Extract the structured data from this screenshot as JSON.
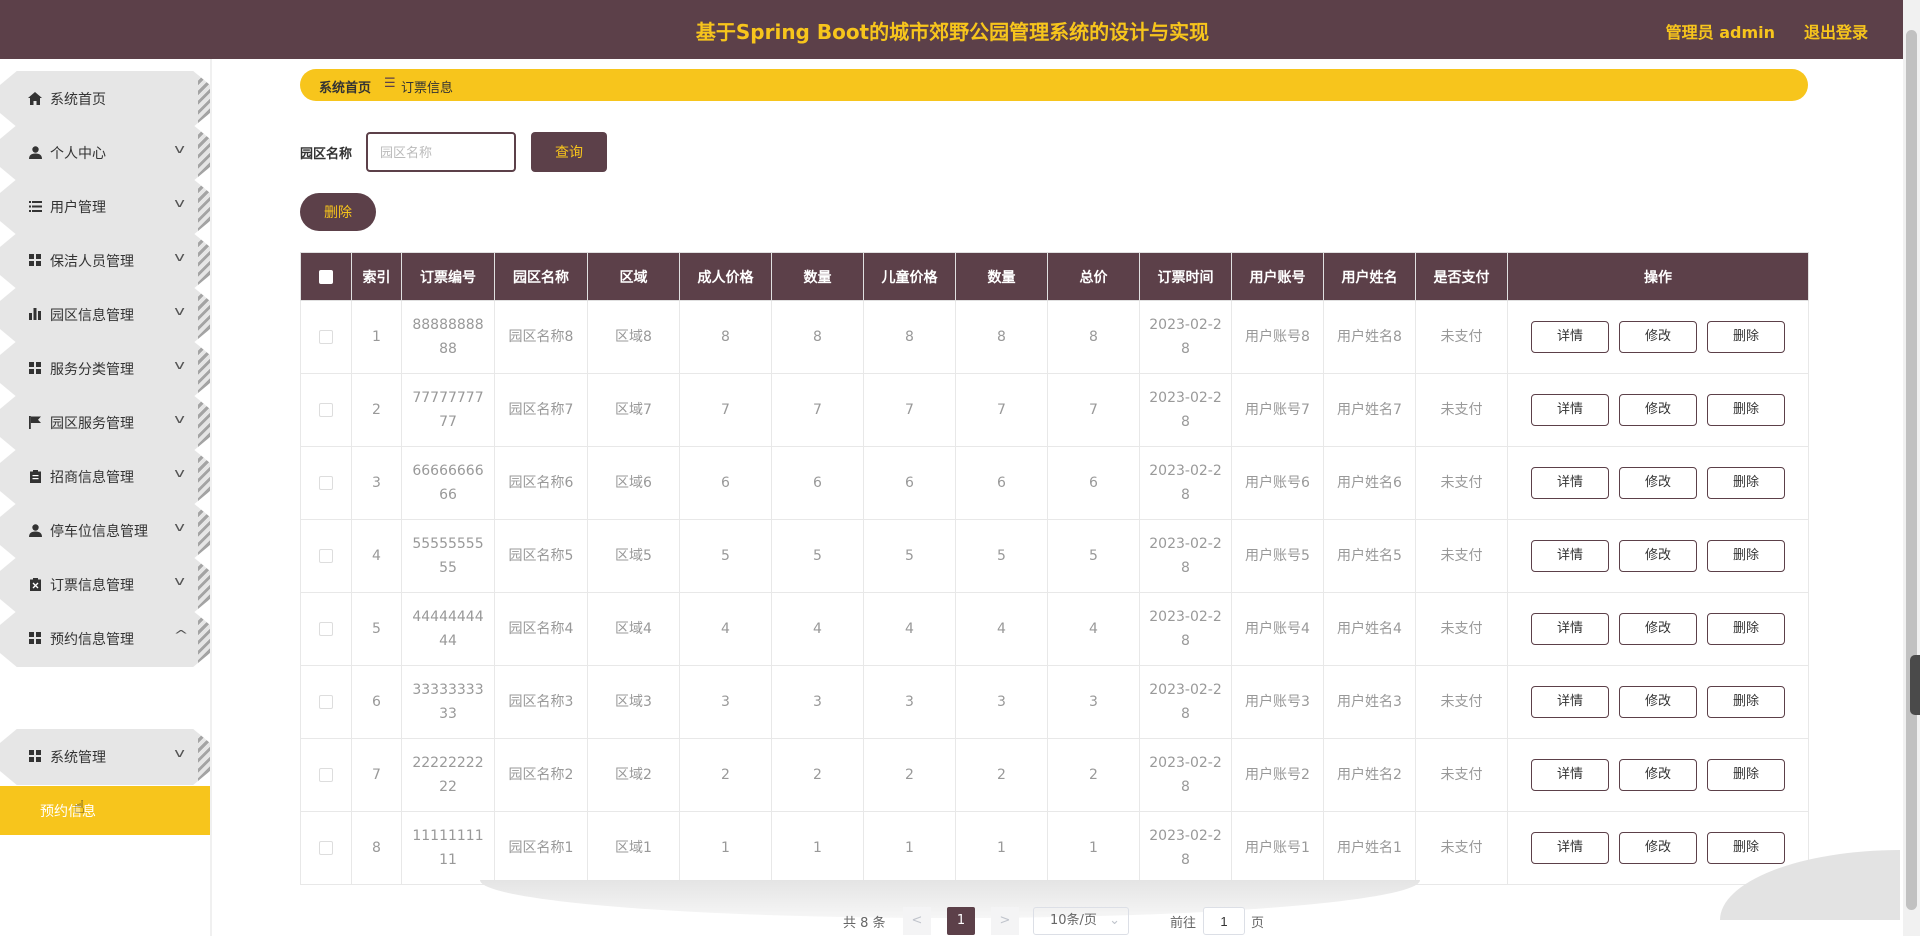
{
  "header": {
    "title": "基于Spring Boot的城市郊野公园管理系统的设计与实现",
    "user": "管理员 admin",
    "logout": "退出登录"
  },
  "sidebar": {
    "items": [
      {
        "label": "系统首页",
        "icon": "home-icon",
        "expandable": false
      },
      {
        "label": "个人中心",
        "icon": "person-icon",
        "expandable": true
      },
      {
        "label": "用户管理",
        "icon": "list-icon",
        "expandable": true
      },
      {
        "label": "保洁人员管理",
        "icon": "grid-icon",
        "expandable": true
      },
      {
        "label": "园区信息管理",
        "icon": "bar-chart-icon",
        "expandable": true
      },
      {
        "label": "服务分类管理",
        "icon": "grid-icon",
        "expandable": true
      },
      {
        "label": "园区服务管理",
        "icon": "flag-icon",
        "expandable": true
      },
      {
        "label": "招商信息管理",
        "icon": "clipboard-icon",
        "expandable": true
      },
      {
        "label": "停车位信息管理",
        "icon": "person-icon",
        "expandable": true
      },
      {
        "label": "订票信息管理",
        "icon": "clipboard-x-icon",
        "expandable": true
      },
      {
        "label": "预约信息管理",
        "icon": "grid-icon",
        "expandable": true,
        "expanded": true
      },
      {
        "label": "系统管理",
        "icon": "grid-icon",
        "expandable": true
      }
    ],
    "submenu_label": "预约信息"
  },
  "breadcrumb": {
    "home": "系统首页",
    "separator": "☰",
    "current": "订票信息"
  },
  "search": {
    "label": "园区名称",
    "placeholder": "园区名称",
    "value": "",
    "button": "查询"
  },
  "actions": {
    "delete": "删除"
  },
  "table": {
    "headers": [
      "索引",
      "订票编号",
      "园区名称",
      "区域",
      "成人价格",
      "数量",
      "儿童价格",
      "数量",
      "总价",
      "订票时间",
      "用户账号",
      "用户姓名",
      "是否支付",
      "操作"
    ],
    "rows": [
      [
        "1",
        "8888888888",
        "园区名称8",
        "区域8",
        "8",
        "8",
        "8",
        "8",
        "8",
        "2023-02-28",
        "用户账号8",
        "用户姓名8",
        "未支付"
      ],
      [
        "2",
        "7777777777",
        "园区名称7",
        "区域7",
        "7",
        "7",
        "7",
        "7",
        "7",
        "2023-02-28",
        "用户账号7",
        "用户姓名7",
        "未支付"
      ],
      [
        "3",
        "6666666666",
        "园区名称6",
        "区域6",
        "6",
        "6",
        "6",
        "6",
        "6",
        "2023-02-28",
        "用户账号6",
        "用户姓名6",
        "未支付"
      ],
      [
        "4",
        "5555555555",
        "园区名称5",
        "区域5",
        "5",
        "5",
        "5",
        "5",
        "5",
        "2023-02-28",
        "用户账号5",
        "用户姓名5",
        "未支付"
      ],
      [
        "5",
        "4444444444",
        "园区名称4",
        "区域4",
        "4",
        "4",
        "4",
        "4",
        "4",
        "2023-02-28",
        "用户账号4",
        "用户姓名4",
        "未支付"
      ],
      [
        "6",
        "3333333333",
        "园区名称3",
        "区域3",
        "3",
        "3",
        "3",
        "3",
        "3",
        "2023-02-28",
        "用户账号3",
        "用户姓名3",
        "未支付"
      ],
      [
        "7",
        "2222222222",
        "园区名称2",
        "区域2",
        "2",
        "2",
        "2",
        "2",
        "2",
        "2023-02-28",
        "用户账号2",
        "用户姓名2",
        "未支付"
      ],
      [
        "8",
        "1111111111",
        "园区名称1",
        "区域1",
        "1",
        "1",
        "1",
        "1",
        "1",
        "2023-02-28",
        "用户账号1",
        "用户姓名1",
        "未支付"
      ]
    ],
    "row_actions": [
      "详情",
      "修改",
      "删除"
    ]
  },
  "pagination": {
    "total": "共 8 条",
    "prev": "<",
    "current_page": "1",
    "next": ">",
    "page_size": "10条/页",
    "goto_label": "前往",
    "goto_value": "1",
    "page_suffix": "页"
  },
  "colors": {
    "primary": "#5c4049",
    "accent": "#f7c51c"
  }
}
